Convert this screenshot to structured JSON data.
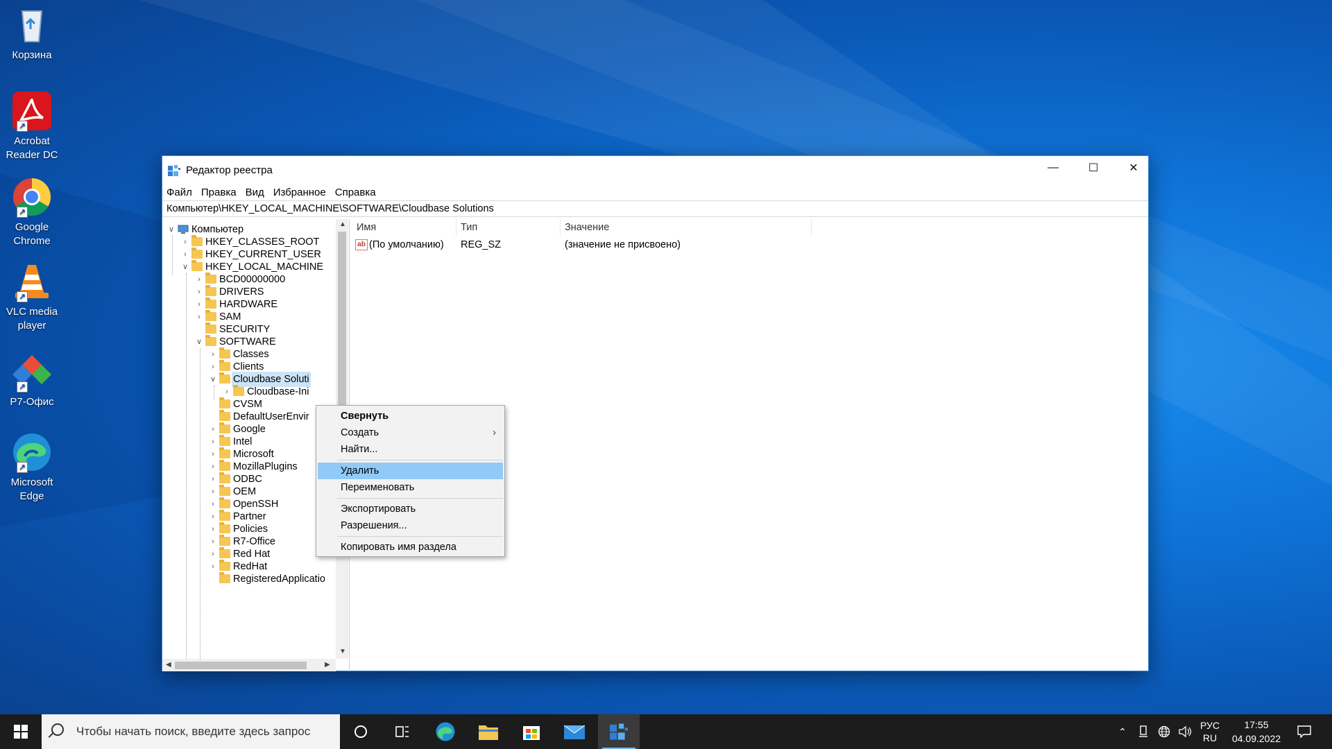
{
  "desktop": {
    "icons": [
      {
        "label": "Корзина"
      },
      {
        "label": "Acrobat Reader DC"
      },
      {
        "label": "Google Chrome"
      },
      {
        "label": "VLC media player"
      },
      {
        "label": "Р7-Офис"
      },
      {
        "label": "Microsoft Edge"
      }
    ]
  },
  "window": {
    "title": "Редактор реестра",
    "menu": [
      "Файл",
      "Правка",
      "Вид",
      "Избранное",
      "Справка"
    ],
    "address": "Компьютер\\HKEY_LOCAL_MACHINE\\SOFTWARE\\Cloudbase Solutions",
    "controls": {
      "minimize": "—",
      "maximize": "☐",
      "close": "✕"
    }
  },
  "tree": {
    "root": "Компьютер",
    "hives": [
      "HKEY_CLASSES_ROOT",
      "HKEY_CURRENT_USER",
      "HKEY_LOCAL_MACHINE"
    ],
    "hklm": [
      "BCD00000000",
      "DRIVERS",
      "HARDWARE",
      "SAM",
      "SECURITY",
      "SOFTWARE"
    ],
    "software": [
      "Classes",
      "Clients",
      "Cloudbase Soluti",
      "CVSM",
      "DefaultUserEnvir",
      "Google",
      "Intel",
      "Microsoft",
      "MozillaPlugins",
      "ODBC",
      "OEM",
      "OpenSSH",
      "Partner",
      "Policies",
      "R7-Office",
      "Red Hat",
      "RedHat",
      "RegisteredApplicatio"
    ],
    "cloudbase_child": "Cloudbase-Ini"
  },
  "list": {
    "columns": [
      "Имя",
      "Тип",
      "Значение"
    ],
    "rows": [
      {
        "name": "(По умолчанию)",
        "type": "REG_SZ",
        "value": "(значение не присвоено)"
      }
    ]
  },
  "context_menu": {
    "items": [
      {
        "label": "Свернуть",
        "bold": true
      },
      {
        "label": "Создать",
        "submenu": true
      },
      {
        "label": "Найти..."
      },
      {
        "label": "Удалить",
        "highlighted": true
      },
      {
        "label": "Переименовать"
      },
      {
        "label": "Экспортировать"
      },
      {
        "label": "Разрешения..."
      },
      {
        "label": "Копировать имя раздела"
      }
    ]
  },
  "taskbar": {
    "search_placeholder": "Чтобы начать поиск, введите здесь запрос",
    "lang_top": "РУС",
    "lang_bottom": "RU",
    "time": "17:55",
    "date": "04.09.2022"
  },
  "colors": {
    "accent": "#0078d7",
    "menu_highlight": "#91c9f7",
    "selection": "#cce4f7",
    "taskbar": "#1c1c1c"
  }
}
